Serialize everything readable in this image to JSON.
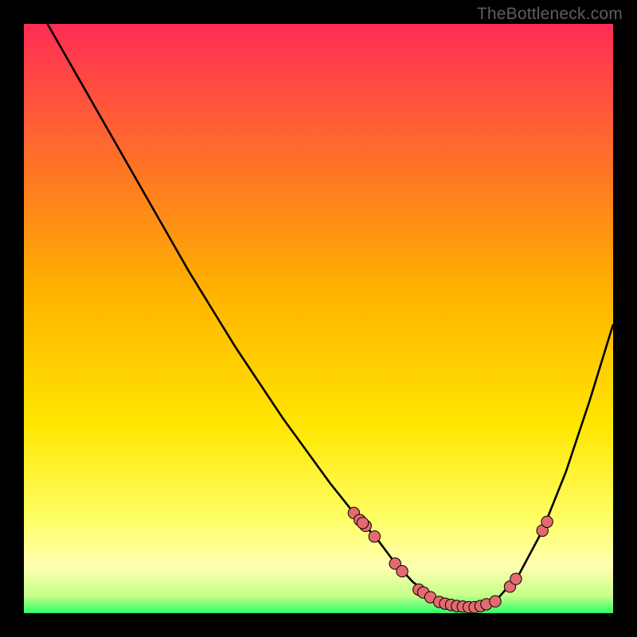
{
  "watermark": "TheBottleneck.com",
  "colors": {
    "background": "#000000",
    "gradient_top": "#ff2c55",
    "gradient_mid": "#ffd400",
    "gradient_low": "#ffff99",
    "gradient_bottom": "#2eff6a",
    "curve": "#000000",
    "marker_fill": "#e46a6f",
    "marker_stroke": "#000000"
  },
  "chart_data": {
    "type": "line",
    "title": "",
    "xlabel": "",
    "ylabel": "",
    "xlim": [
      0,
      100
    ],
    "ylim": [
      0,
      100
    ],
    "curve": {
      "name": "bottleneck-curve",
      "x": [
        4,
        8,
        12,
        16,
        20,
        24,
        28,
        32,
        36,
        40,
        44,
        48,
        52,
        56,
        60,
        63,
        66,
        69,
        72,
        76,
        80,
        84,
        88,
        92,
        96,
        100
      ],
      "y": [
        100,
        93,
        86,
        79,
        72,
        65,
        58,
        51.5,
        45,
        39,
        33,
        27.5,
        22,
        17,
        12.5,
        8.5,
        5.3,
        3.0,
        1.6,
        1.0,
        2.0,
        6.5,
        14,
        24,
        36,
        49
      ]
    },
    "markers": [
      {
        "x": 56.0,
        "y": 17.0
      },
      {
        "x": 57.0,
        "y": 15.8
      },
      {
        "x": 58.0,
        "y": 14.8
      },
      {
        "x": 57.5,
        "y": 15.3
      },
      {
        "x": 59.5,
        "y": 13.0
      },
      {
        "x": 63.0,
        "y": 8.4
      },
      {
        "x": 64.2,
        "y": 7.1
      },
      {
        "x": 67.0,
        "y": 4.0
      },
      {
        "x": 67.8,
        "y": 3.5
      },
      {
        "x": 69.0,
        "y": 2.7
      },
      {
        "x": 70.5,
        "y": 1.9
      },
      {
        "x": 71.5,
        "y": 1.6
      },
      {
        "x": 72.5,
        "y": 1.4
      },
      {
        "x": 73.5,
        "y": 1.2
      },
      {
        "x": 74.5,
        "y": 1.1
      },
      {
        "x": 75.5,
        "y": 1.0
      },
      {
        "x": 76.5,
        "y": 1.0
      },
      {
        "x": 77.5,
        "y": 1.2
      },
      {
        "x": 78.5,
        "y": 1.5
      },
      {
        "x": 80.0,
        "y": 2.0
      },
      {
        "x": 82.5,
        "y": 4.5
      },
      {
        "x": 83.5,
        "y": 5.8
      },
      {
        "x": 88.0,
        "y": 14.0
      },
      {
        "x": 88.8,
        "y": 15.5
      }
    ]
  }
}
